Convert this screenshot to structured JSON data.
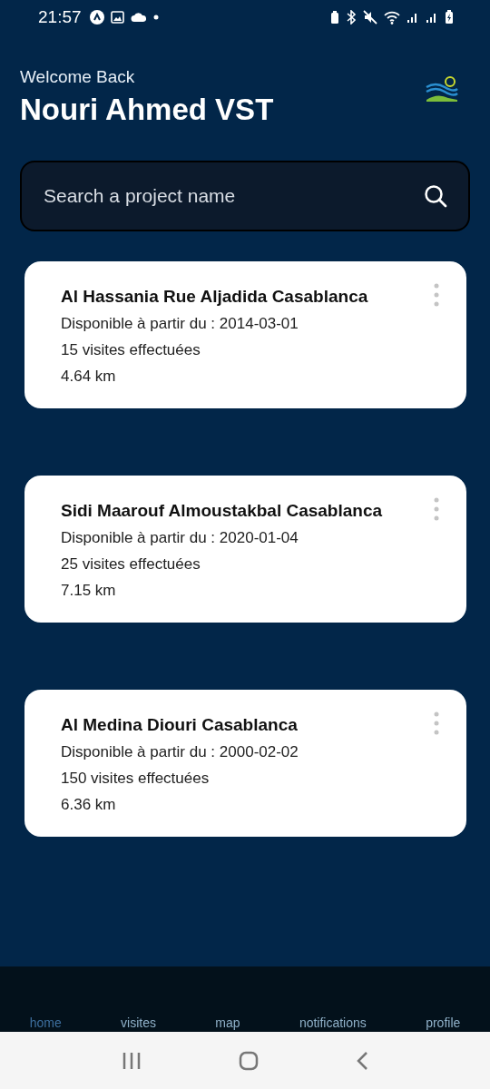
{
  "status_bar": {
    "time": "21:57"
  },
  "header": {
    "greeting": "Welcome Back",
    "user_name": "Nouri Ahmed VST"
  },
  "search": {
    "placeholder": "Search a project name"
  },
  "projects": [
    {
      "name": "Al Hassania Rue Aljadida Casablanca",
      "available": "Disponible à partir du : 2014-03-01",
      "visits": "15 visites effectuées",
      "distance": "4.64 km"
    },
    {
      "name": "Sidi Maarouf Almoustakbal Casablanca",
      "available": "Disponible à partir du : 2020-01-04",
      "visits": "25 visites effectuées",
      "distance": "7.15 km"
    },
    {
      "name": "Al Medina Diouri Casablanca",
      "available": "Disponible à partir du : 2000-02-02",
      "visits": "150 visites effectuées",
      "distance": "6.36 km"
    }
  ],
  "bottom_nav": [
    {
      "label": "home",
      "selected": true
    },
    {
      "label": "visites",
      "selected": false
    },
    {
      "label": "map",
      "selected": false
    },
    {
      "label": "notifications",
      "selected": false
    },
    {
      "label": "profile",
      "selected": false
    }
  ]
}
